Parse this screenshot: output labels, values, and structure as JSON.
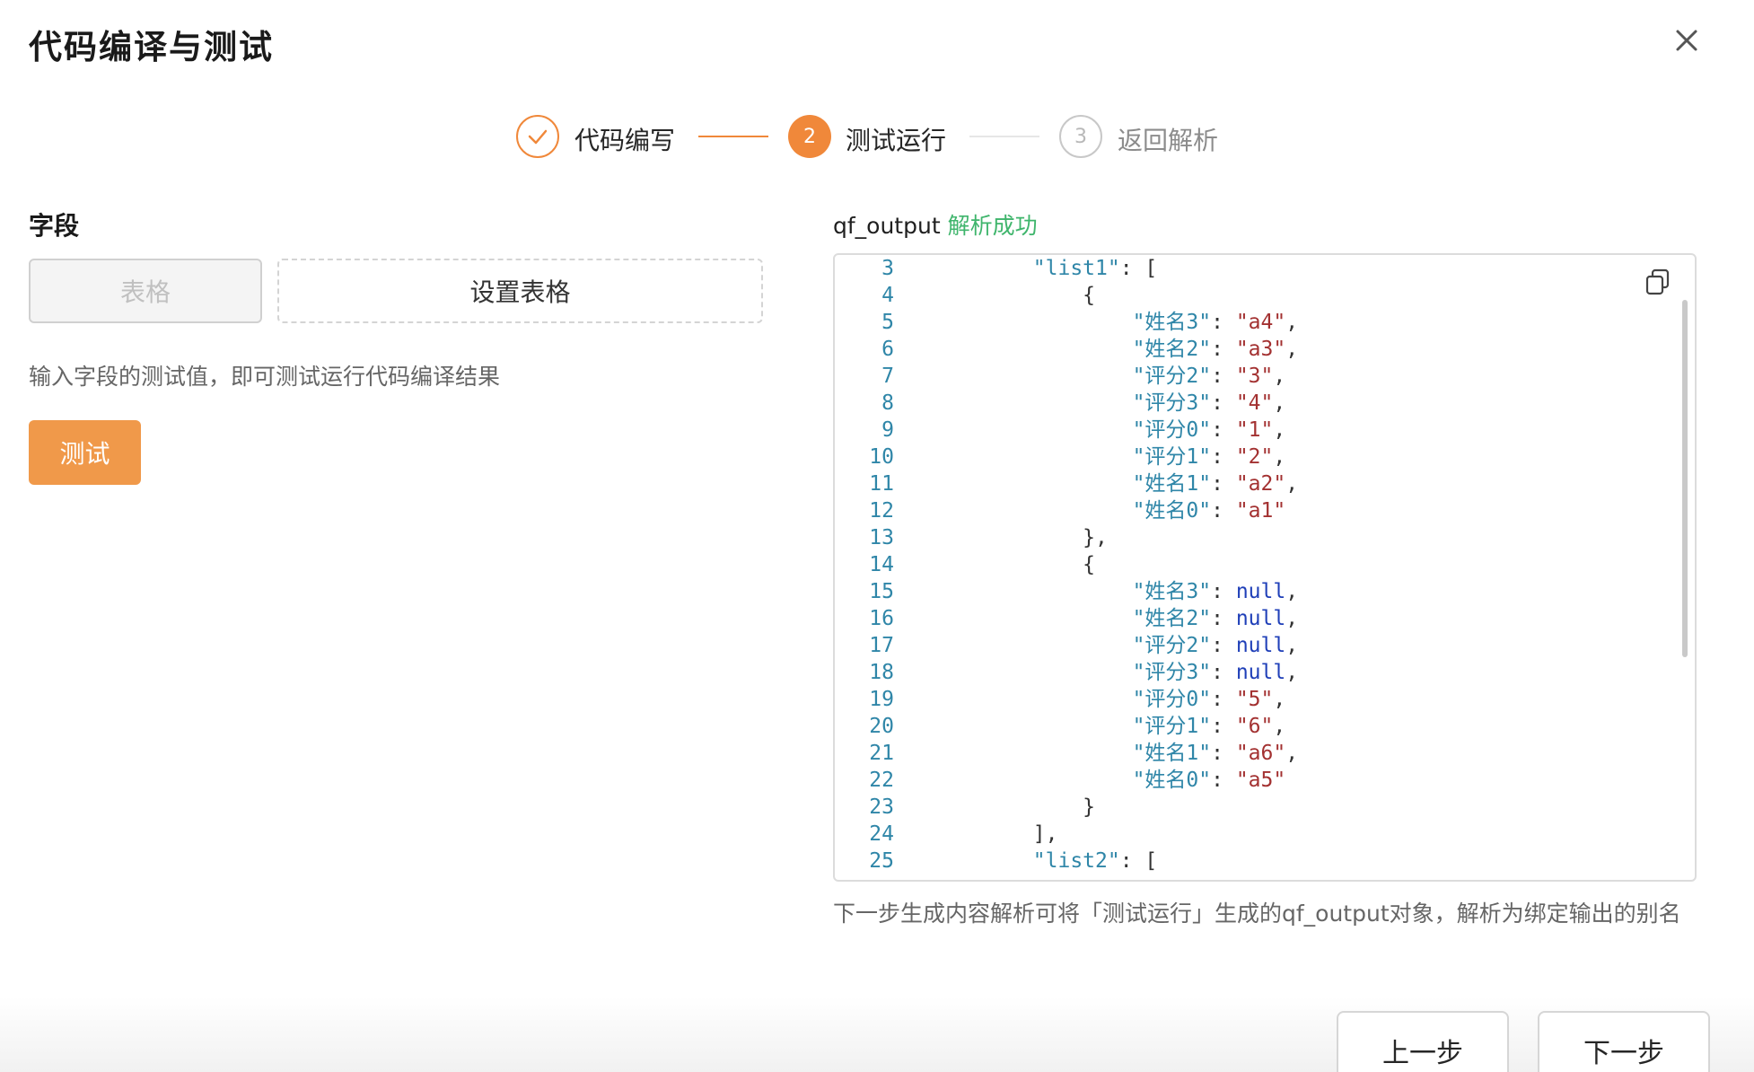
{
  "dialog": {
    "title": "代码编译与测试"
  },
  "steps": [
    {
      "label": "代码编写",
      "status": "done"
    },
    {
      "number": "2",
      "label": "测试运行",
      "status": "active"
    },
    {
      "number": "3",
      "label": "返回解析",
      "status": "pending"
    }
  ],
  "left": {
    "field_label": "字段",
    "table_button": "表格",
    "setup_button": "设置表格",
    "hint": "输入字段的测试值，即可测试运行代码编译结果",
    "test_button": "测试"
  },
  "right": {
    "output_name": "qf_output",
    "output_status": "解析成功",
    "code_lines": [
      {
        "n": "3",
        "ind": "        ",
        "k": "\"list1\"",
        "p1": ": ",
        "v": "[",
        "vt": "p",
        "p2": ""
      },
      {
        "n": "4",
        "ind": "            ",
        "k": "",
        "p1": "",
        "v": "{",
        "vt": "p",
        "p2": ""
      },
      {
        "n": "5",
        "ind": "                ",
        "k": "\"姓名3\"",
        "p1": ": ",
        "v": "\"a4\"",
        "vt": "s",
        "p2": ","
      },
      {
        "n": "6",
        "ind": "                ",
        "k": "\"姓名2\"",
        "p1": ": ",
        "v": "\"a3\"",
        "vt": "s",
        "p2": ","
      },
      {
        "n": "7",
        "ind": "                ",
        "k": "\"评分2\"",
        "p1": ": ",
        "v": "\"3\"",
        "vt": "s",
        "p2": ","
      },
      {
        "n": "8",
        "ind": "                ",
        "k": "\"评分3\"",
        "p1": ": ",
        "v": "\"4\"",
        "vt": "s",
        "p2": ","
      },
      {
        "n": "9",
        "ind": "                ",
        "k": "\"评分0\"",
        "p1": ": ",
        "v": "\"1\"",
        "vt": "s",
        "p2": ","
      },
      {
        "n": "10",
        "ind": "                ",
        "k": "\"评分1\"",
        "p1": ": ",
        "v": "\"2\"",
        "vt": "s",
        "p2": ","
      },
      {
        "n": "11",
        "ind": "                ",
        "k": "\"姓名1\"",
        "p1": ": ",
        "v": "\"a2\"",
        "vt": "s",
        "p2": ","
      },
      {
        "n": "12",
        "ind": "                ",
        "k": "\"姓名0\"",
        "p1": ": ",
        "v": "\"a1\"",
        "vt": "s",
        "p2": ""
      },
      {
        "n": "13",
        "ind": "            ",
        "k": "",
        "p1": "",
        "v": "},",
        "vt": "p",
        "p2": ""
      },
      {
        "n": "14",
        "ind": "            ",
        "k": "",
        "p1": "",
        "v": "{",
        "vt": "p",
        "p2": ""
      },
      {
        "n": "15",
        "ind": "                ",
        "k": "\"姓名3\"",
        "p1": ": ",
        "v": "null",
        "vt": "n",
        "p2": ","
      },
      {
        "n": "16",
        "ind": "                ",
        "k": "\"姓名2\"",
        "p1": ": ",
        "v": "null",
        "vt": "n",
        "p2": ","
      },
      {
        "n": "17",
        "ind": "                ",
        "k": "\"评分2\"",
        "p1": ": ",
        "v": "null",
        "vt": "n",
        "p2": ","
      },
      {
        "n": "18",
        "ind": "                ",
        "k": "\"评分3\"",
        "p1": ": ",
        "v": "null",
        "vt": "n",
        "p2": ","
      },
      {
        "n": "19",
        "ind": "                ",
        "k": "\"评分0\"",
        "p1": ": ",
        "v": "\"5\"",
        "vt": "s",
        "p2": ","
      },
      {
        "n": "20",
        "ind": "                ",
        "k": "\"评分1\"",
        "p1": ": ",
        "v": "\"6\"",
        "vt": "s",
        "p2": ","
      },
      {
        "n": "21",
        "ind": "                ",
        "k": "\"姓名1\"",
        "p1": ": ",
        "v": "\"a6\"",
        "vt": "s",
        "p2": ","
      },
      {
        "n": "22",
        "ind": "                ",
        "k": "\"姓名0\"",
        "p1": ": ",
        "v": "\"a5\"",
        "vt": "s",
        "p2": ""
      },
      {
        "n": "23",
        "ind": "            ",
        "k": "",
        "p1": "",
        "v": "}",
        "vt": "p",
        "p2": ""
      },
      {
        "n": "24",
        "ind": "        ",
        "k": "",
        "p1": "",
        "v": "],",
        "vt": "p",
        "p2": ""
      },
      {
        "n": "25",
        "ind": "        ",
        "k": "\"list2\"",
        "p1": ": ",
        "v": "[",
        "vt": "p",
        "p2": ""
      }
    ],
    "footer_note": "下一步生成内容解析可将「测试运行」生成的qf_output对象，解析为绑定输出的别名"
  },
  "footer": {
    "prev_button": "上一步",
    "next_button": "下一步"
  },
  "colors": {
    "accent": "#f0883a",
    "success": "#3fb56c"
  },
  "icons": {
    "close": "close-icon",
    "check": "check-icon",
    "copy": "copy-icon"
  }
}
